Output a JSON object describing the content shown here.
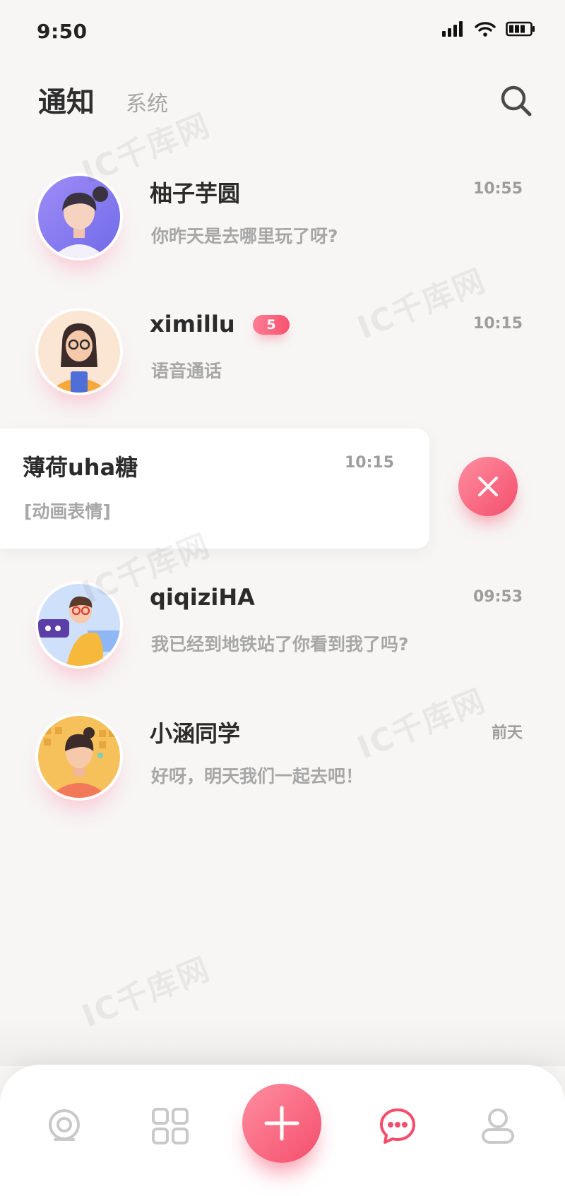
{
  "status_bar": {
    "time": "9:50",
    "icons": [
      "signal-icon",
      "wifi-icon",
      "battery-icon"
    ]
  },
  "header": {
    "tab_notifications": "通知",
    "tab_system": "系统",
    "search_icon": "search-icon"
  },
  "conversations": [
    {
      "name": "柚子芋圆",
      "time": "10:55",
      "message": "你昨天是去哪里玩了呀?",
      "badge": null,
      "avatar": "avatar-purple"
    },
    {
      "name": "ximillu",
      "time": "10:15",
      "message": "语音通话",
      "badge": "5",
      "avatar": "avatar-peach"
    },
    {
      "name": "薄荷uha糖",
      "time": "10:15",
      "message": "[动画表情]",
      "badge": null,
      "swiped": true
    },
    {
      "name": "qiqiziHA",
      "time": "09:53",
      "message": "我已经到地铁站了你看到我了吗?",
      "badge": null,
      "avatar": "avatar-blue"
    },
    {
      "name": "小涵同学",
      "time": "前天",
      "message": "好呀，明天我们一起去吧！",
      "badge": null,
      "avatar": "avatar-orange"
    }
  ],
  "swipe_action": {
    "icon": "close-icon",
    "color": "#f44e6c"
  },
  "tab_bar": {
    "items": [
      "home-icon",
      "grid-icon",
      "add-icon",
      "chat-icon",
      "profile-icon"
    ],
    "active": "chat-icon",
    "accent": "#f44e6c"
  },
  "watermark": "IC千库网"
}
